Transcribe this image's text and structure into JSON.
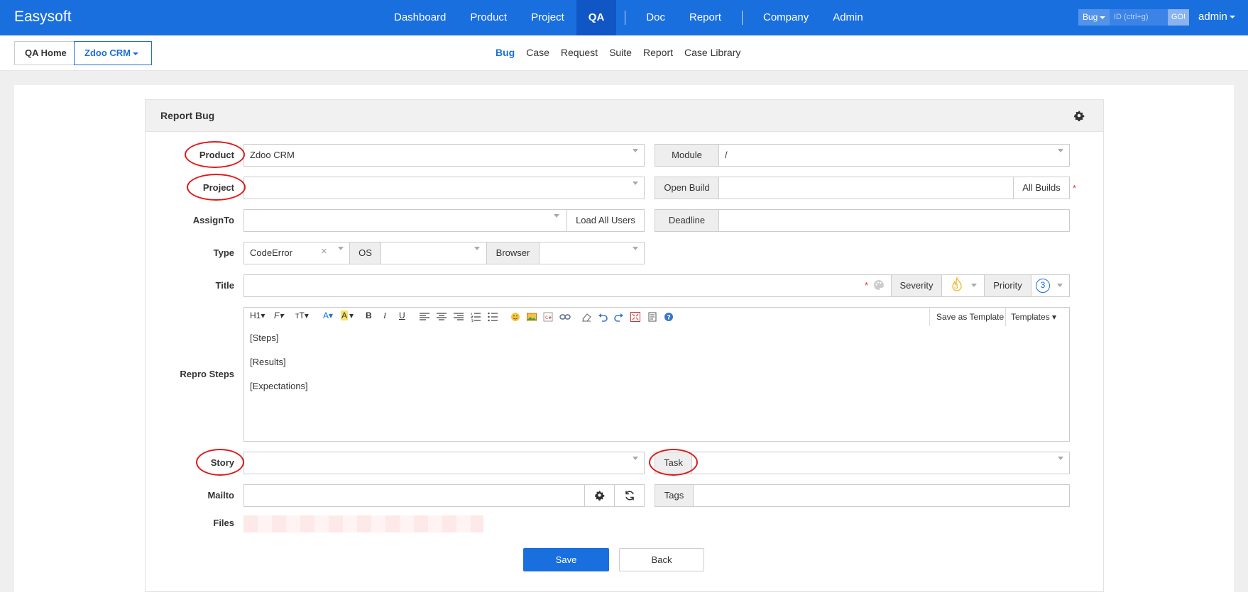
{
  "app": {
    "brand": "Easysoft"
  },
  "main_nav": {
    "items": [
      "Dashboard",
      "Product",
      "Project",
      "QA",
      "Doc",
      "Report",
      "Company",
      "Admin"
    ],
    "active": "QA"
  },
  "quick_search": {
    "type": "Bug",
    "placeholder": "ID (ctrl+g)",
    "go": "GO!"
  },
  "user": {
    "name": "admin"
  },
  "breadcrumb": {
    "home": "QA Home",
    "product": "Zdoo CRM"
  },
  "sub_nav": {
    "items": [
      "Bug",
      "Case",
      "Request",
      "Suite",
      "Report",
      "Case Library"
    ],
    "active": "Bug"
  },
  "form": {
    "title": "Report Bug",
    "labels": {
      "product": "Product",
      "project": "Project",
      "assign_to": "AssignTo",
      "type": "Type",
      "title": "Title",
      "repro_steps": "Repro Steps",
      "story": "Story",
      "mailto": "Mailto",
      "files": "Files"
    },
    "values": {
      "product": "Zdoo CRM",
      "module": "/",
      "type": "CodeError"
    },
    "addons": {
      "module": "Module",
      "open_build": "Open Build",
      "all_builds": "All Builds",
      "load_all_users": "Load All Users",
      "deadline": "Deadline",
      "os": "OS",
      "browser": "Browser",
      "severity": "Severity",
      "severity_value": "3",
      "priority": "Priority",
      "priority_value": "3",
      "task": "Task",
      "tags": "Tags"
    },
    "required_mark": "*",
    "editor": {
      "toolbar": {
        "heading": "H1",
        "font": "F",
        "font_size": "тT",
        "font_color": "A",
        "bg_color": "A",
        "bold": "B",
        "italic": "I",
        "underline": "U",
        "save_template": "Save as Template",
        "templates": "Templates"
      },
      "lines": [
        "[Steps]",
        "[Results]",
        "[Expectations]"
      ]
    },
    "buttons": {
      "save": "Save",
      "back": "Back"
    }
  },
  "colors": {
    "primary": "#1a6fdf",
    "header_bg": "#1a6fdf",
    "highlight_oval": "#e01818",
    "required": "#e4393c"
  }
}
